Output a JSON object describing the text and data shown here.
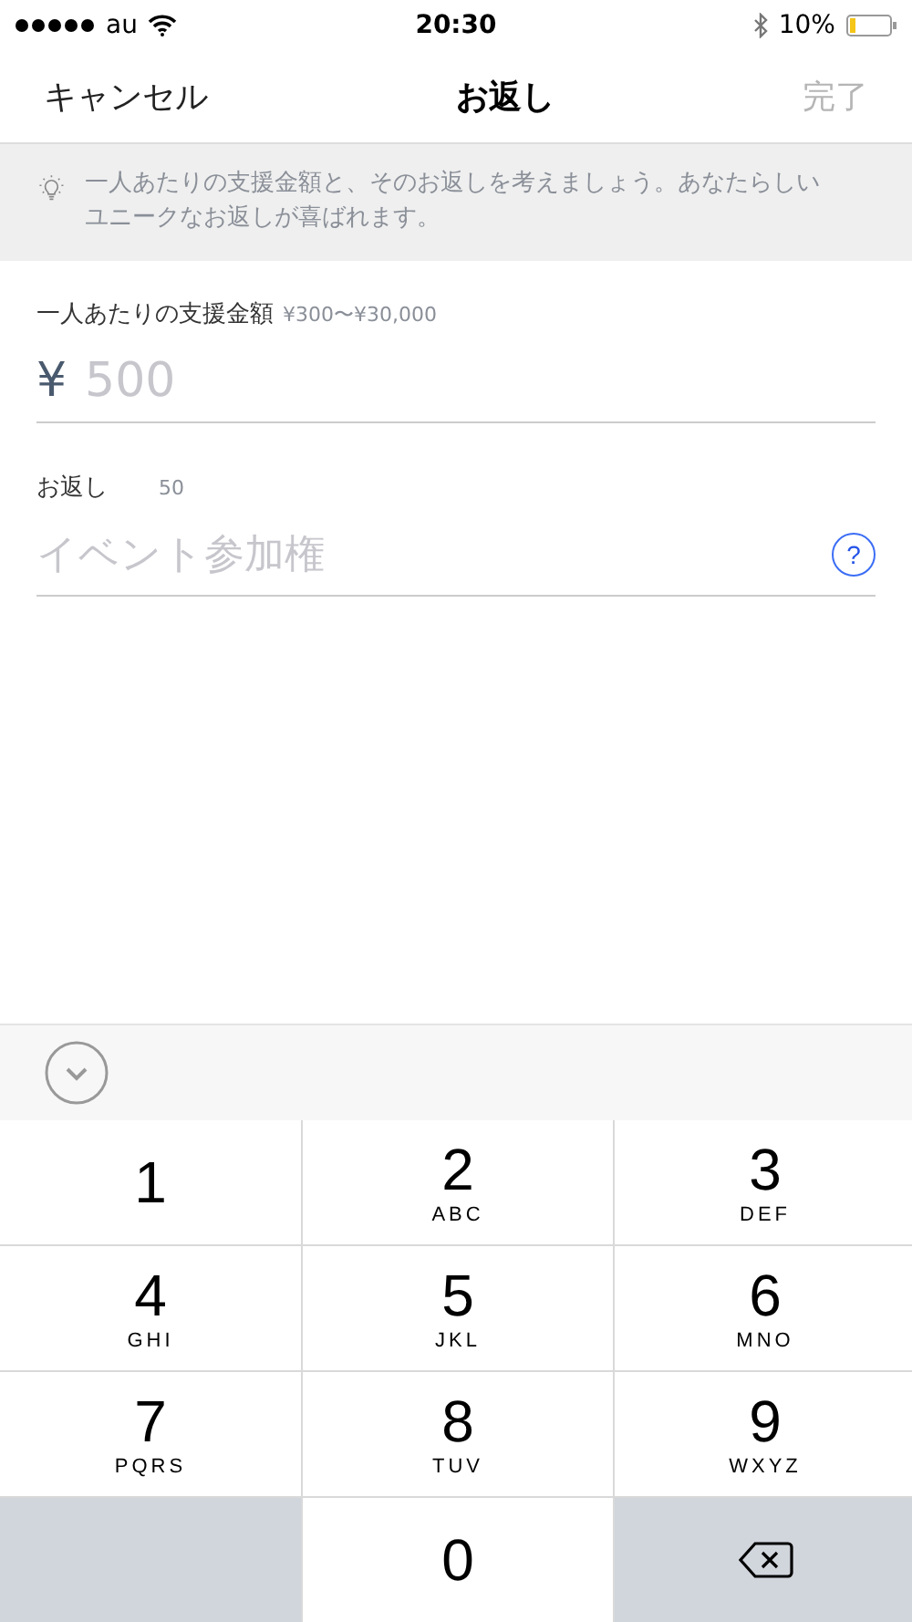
{
  "status_bar": {
    "carrier": "au",
    "time": "20:30",
    "battery": "10%"
  },
  "nav": {
    "cancel": "キャンセル",
    "title": "お返し",
    "done": {
      "label": "完了",
      "disabled": true
    }
  },
  "tip": {
    "text": "一人あたりの支援金額と、そのお返しを考えましょう。あなたらしいユニークなお返しが喜ばれます。"
  },
  "amount": {
    "label": "一人あたりの支援金額",
    "range": "¥300〜¥30,000",
    "currency": "¥",
    "placeholder": "500"
  },
  "reward": {
    "label": "お返し",
    "count": "50",
    "placeholder": "イベント参加権",
    "help": "?"
  },
  "keypad": [
    {
      "kind": "digit",
      "digit": "1"
    },
    {
      "kind": "digit",
      "digit": "2",
      "letters": "ABC"
    },
    {
      "kind": "digit",
      "digit": "3",
      "letters": "DEF"
    },
    {
      "kind": "digit",
      "digit": "4",
      "letters": "GHI"
    },
    {
      "kind": "digit",
      "digit": "5",
      "letters": "JKL"
    },
    {
      "kind": "digit",
      "digit": "6",
      "letters": "MNO"
    },
    {
      "kind": "digit",
      "digit": "7",
      "letters": "PQRS"
    },
    {
      "kind": "digit",
      "digit": "8",
      "letters": "TUV"
    },
    {
      "kind": "digit",
      "digit": "9",
      "letters": "WXYZ"
    },
    {
      "kind": "blank"
    },
    {
      "kind": "digit",
      "digit": "0"
    },
    {
      "kind": "delete"
    }
  ]
}
